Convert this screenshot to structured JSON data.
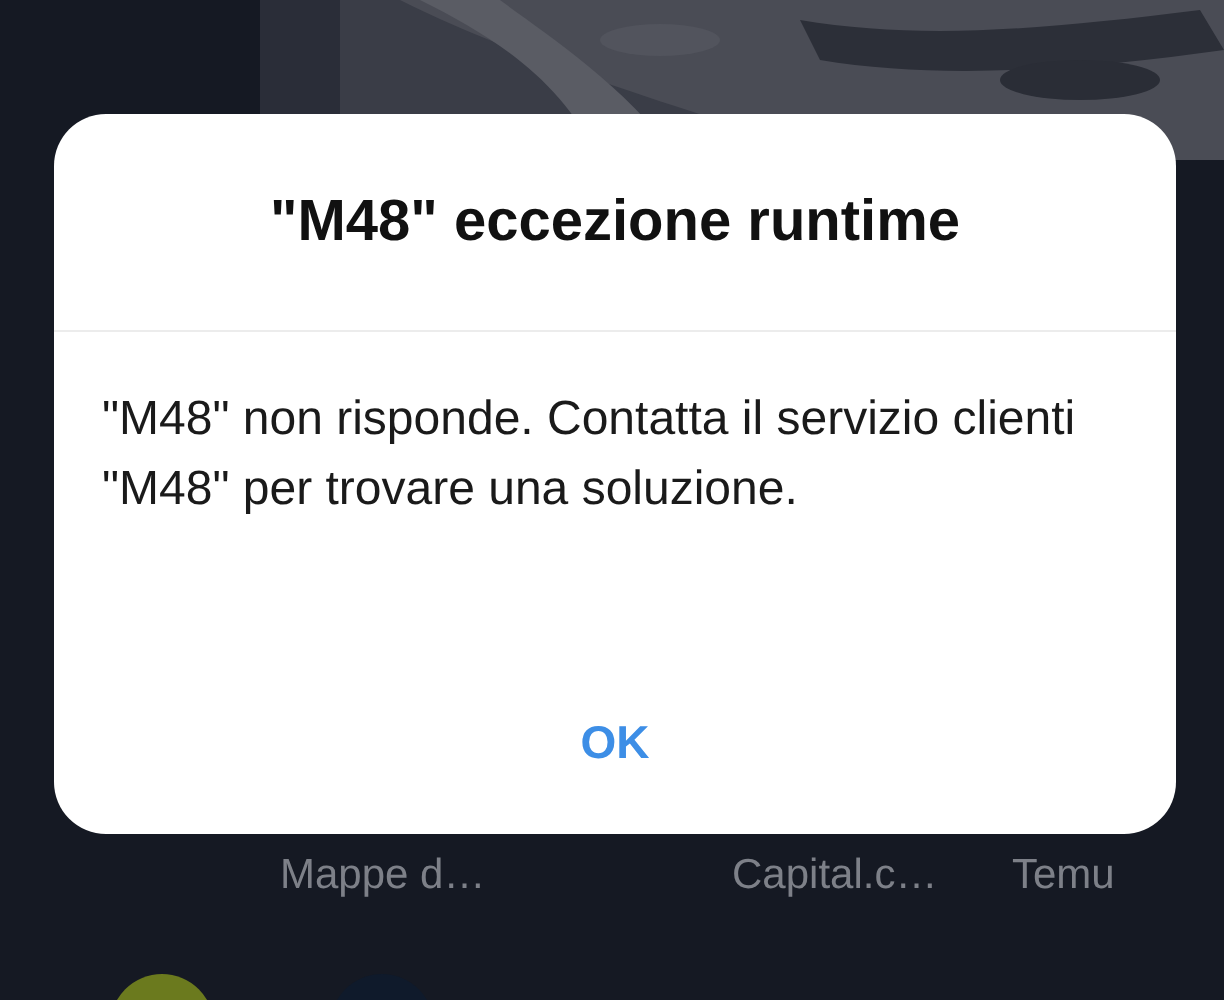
{
  "dialog": {
    "title": "\"M48\" eccezione runtime",
    "message": "\"M48\" non risponde. Contatta il servizio clienti \"M48\" per trovare una soluzione.",
    "button": "OK"
  },
  "home_apps": [
    {
      "label": "Mappe d…"
    },
    {
      "label": "Capital.c…"
    },
    {
      "label": "Temu"
    }
  ],
  "dock_icons": [
    {
      "color": "#6b7a1e"
    },
    {
      "color": "#0f1a2b"
    }
  ]
}
